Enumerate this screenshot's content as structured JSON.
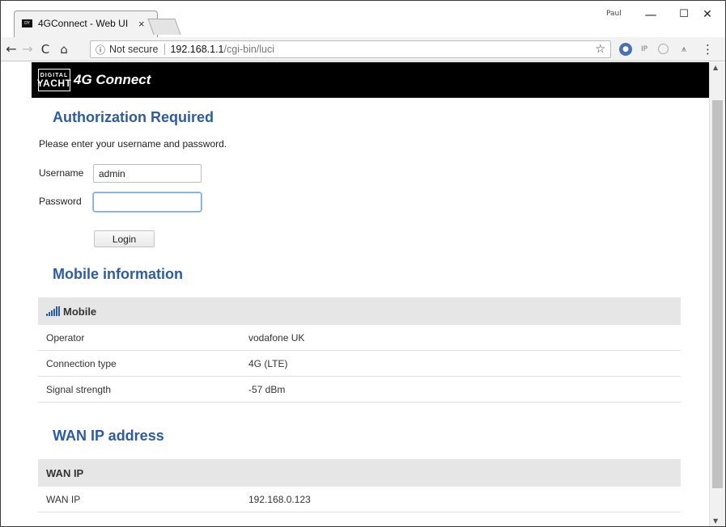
{
  "browser": {
    "tab_title": "4GConnect - Web UI",
    "tab_close": "×",
    "favicon_text": "DY",
    "profile_name": "Paul",
    "window_controls": {
      "minimize": "—",
      "maximize": "☐",
      "close": "✕"
    },
    "nav": {
      "back": "←",
      "forward": "→",
      "reload": "C",
      "home": "⌂"
    },
    "omnibox": {
      "info_icon": "ⓘ",
      "security_text": "Not secure",
      "host": "192.168.1.1",
      "path": "/cgi-bin/luci",
      "star": "☆"
    },
    "extensions": [
      "●",
      "IP",
      "",
      "⩚"
    ],
    "menu": "⋮",
    "scroll_up": "▲",
    "scroll_down": "▼"
  },
  "site": {
    "logo_top": "DIGITAL",
    "logo_bottom": "YACHT",
    "title": "4G Connect"
  },
  "auth": {
    "heading": "Authorization Required",
    "description": "Please enter your username and password.",
    "username_label": "Username",
    "username_value": "admin",
    "password_label": "Password",
    "password_value": "",
    "login_label": "Login"
  },
  "mobile": {
    "heading": "Mobile information",
    "table_title": "Mobile",
    "rows": [
      {
        "label": "Operator",
        "value": "vodafone UK"
      },
      {
        "label": "Connection type",
        "value": "4G (LTE)"
      },
      {
        "label": "Signal strength",
        "value": "-57 dBm"
      }
    ]
  },
  "wan": {
    "heading": "WAN IP address",
    "table_title": "WAN IP",
    "rows": [
      {
        "label": "WAN IP",
        "value": "192.168.0.123"
      }
    ]
  },
  "colors": {
    "heading_blue": "#2e5c9e",
    "header_black": "#000000",
    "table_header_gray": "#e6e6e6"
  }
}
